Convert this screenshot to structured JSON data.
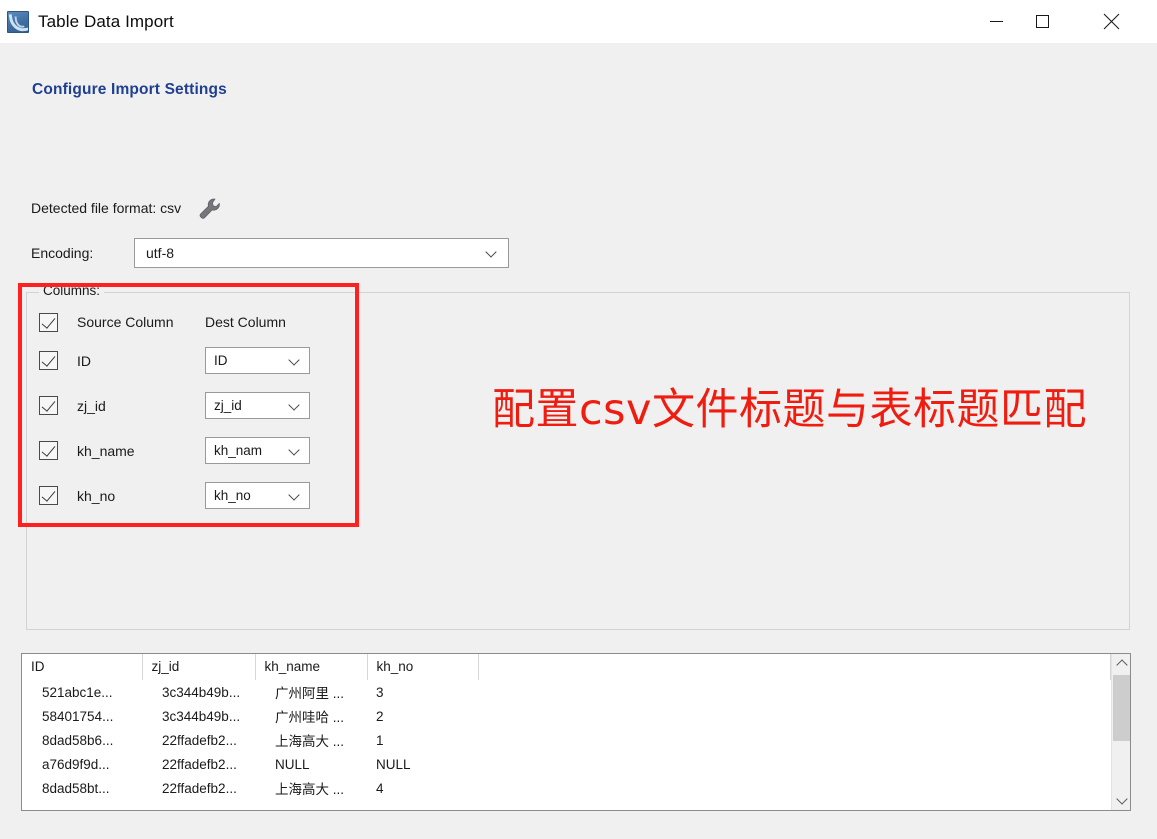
{
  "window": {
    "title": "Table Data Import",
    "icon": "mysql-workbench-icon",
    "controls": {
      "minimize": "minimize-icon",
      "maximize": "maximize-icon",
      "close": "close-icon"
    }
  },
  "page": {
    "heading": "Configure Import Settings",
    "heading_color": "#1f3f8f"
  },
  "detected": {
    "label": "Detected file format: csv",
    "settings_icon": "wrench-icon"
  },
  "encoding": {
    "label": "Encoding:",
    "value": "utf-8",
    "placeholder": "utf-8"
  },
  "columns": {
    "legend": "Columns:",
    "header_source": "Source Column",
    "header_dest": "Dest Column",
    "header_checked": true,
    "rows": [
      {
        "checked": true,
        "source": "ID",
        "dest": "ID"
      },
      {
        "checked": true,
        "source": "zj_id",
        "dest": "zj_id"
      },
      {
        "checked": true,
        "source": "kh_name",
        "dest": "kh_nam"
      },
      {
        "checked": true,
        "source": "kh_no",
        "dest": "kh_no"
      }
    ]
  },
  "annotation": {
    "text": "配置csv文件标题与表标题匹配",
    "color": "#f01c10"
  },
  "preview": {
    "headers": [
      "ID",
      "zj_id",
      "kh_name",
      "kh_no",
      ""
    ],
    "rows": [
      [
        "521abc1e...",
        "3c344b49b...",
        "广州阿里 ...",
        "3",
        ""
      ],
      [
        "58401754...",
        "3c344b49b...",
        "广州哇哈 ...",
        "2",
        ""
      ],
      [
        "8dad58b6...",
        "22ffadefb2...",
        "上海高大 ...",
        "1",
        ""
      ],
      [
        "a76d9f9d...",
        "22ffadefb2...",
        "NULL",
        "NULL",
        ""
      ],
      [
        "8dad58bt...",
        "22ffadefb2...",
        "上海高大 ...",
        "4",
        ""
      ]
    ],
    "scrollbar": {
      "up": "scroll-up-arrow-icon",
      "down": "scroll-down-arrow-icon"
    }
  }
}
